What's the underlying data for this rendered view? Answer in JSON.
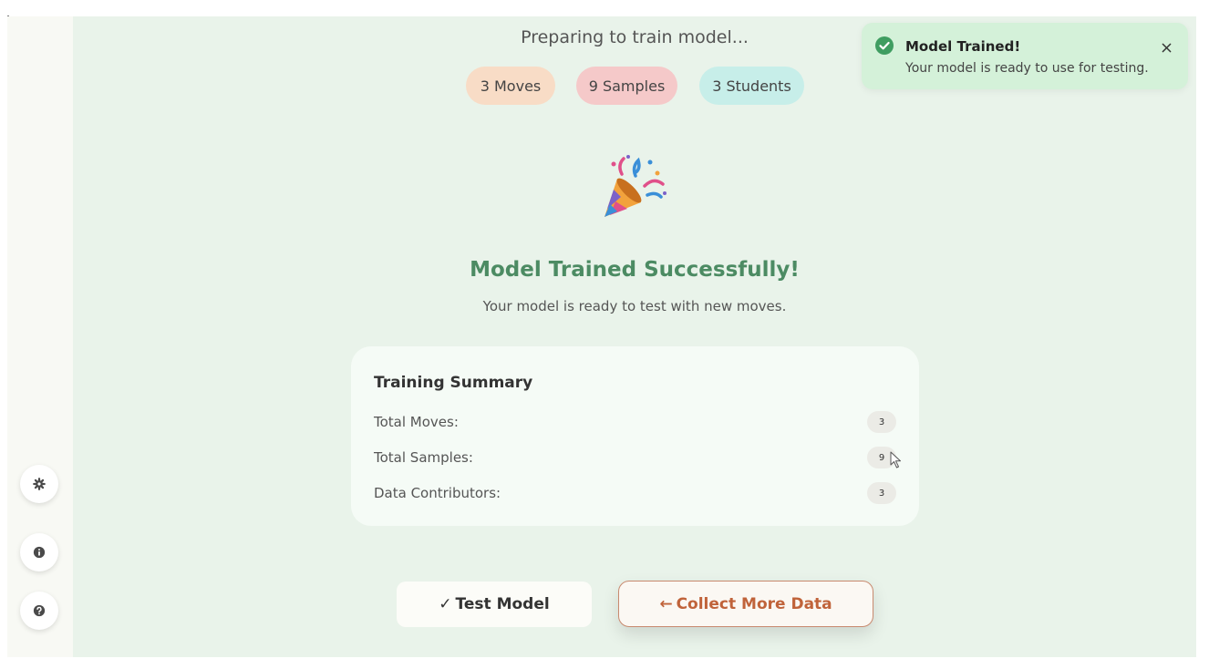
{
  "header": {
    "status_text": "Preparing to train model...",
    "pills": [
      {
        "label": "3 Moves",
        "color": "#f8dcc6"
      },
      {
        "label": "9 Samples",
        "color": "#f5c9c9"
      },
      {
        "label": "3 Students",
        "color": "#c7eee9"
      }
    ]
  },
  "result": {
    "icon": "party-popper-icon",
    "title": "Model Trained Successfully!",
    "subtitle": "Your model is ready to test with new moves."
  },
  "summary": {
    "title": "Training Summary",
    "rows": [
      {
        "label": "Total Moves:",
        "value": "3"
      },
      {
        "label": "Total Samples:",
        "value": "9"
      },
      {
        "label": "Data Contributors:",
        "value": "3"
      }
    ]
  },
  "actions": {
    "test_check": "✓",
    "test_label": "Test Model",
    "collect_arrow": "←",
    "collect_label": "Collect More Data"
  },
  "toast": {
    "title": "Model Trained!",
    "message": "Your model is ready to use for testing.",
    "icon": "check-circle-icon",
    "close_icon": "close-icon"
  },
  "sidebar": {
    "items": [
      {
        "icon": "gear-icon"
      },
      {
        "icon": "info-icon"
      },
      {
        "icon": "help-icon"
      }
    ]
  },
  "colors": {
    "accent_green": "#4c8b63",
    "collect_orange": "#c0633a",
    "background": "#e9f3ea",
    "toast_bg": "#d4f1d9"
  }
}
